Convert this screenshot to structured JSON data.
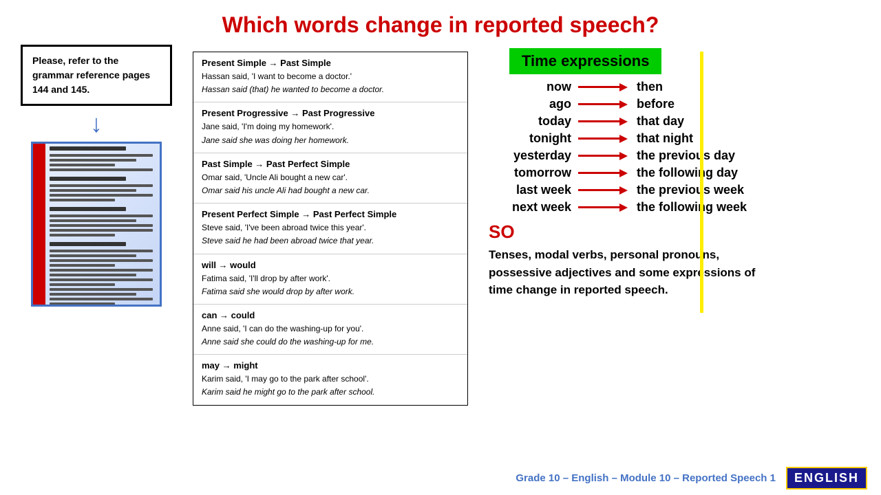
{
  "title": "Which words change in reported speech?",
  "grammar_box": {
    "text": "Please, refer to the grammar reference pages 144 and 145."
  },
  "grammar_sections": [
    {
      "id": "present-simple",
      "title": "Present Simple → Past Simple",
      "lines": [
        "Hassan said, 'I want to become a doctor.'",
        "Hassan said (that) he wanted to become a doctor."
      ],
      "italic": [
        false,
        true
      ]
    },
    {
      "id": "present-progressive",
      "title": "Present Progressive → Past Progressive",
      "lines": [
        "Jane said, 'I'm doing my homework'.",
        "Jane said she was doing her homework."
      ],
      "italic": [
        false,
        true
      ]
    },
    {
      "id": "past-simple",
      "title": "Past Simple → Past Perfect Simple",
      "lines": [
        "Omar said, 'Uncle Ali bought a new car'.",
        "Omar said his uncle Ali had bought a new car."
      ],
      "italic": [
        false,
        true
      ]
    },
    {
      "id": "present-perfect",
      "title": "Present Perfect Simple → Past Perfect Simple",
      "lines": [
        "Steve said, 'I've been abroad twice this year'.",
        "Steve said he had been abroad twice that year."
      ],
      "italic": [
        false,
        true
      ]
    },
    {
      "id": "will-would",
      "title": "will → would",
      "lines": [
        "Fatima said, 'I'll drop by after work'.",
        "Fatima said she would drop by after work."
      ],
      "italic": [
        false,
        true
      ]
    },
    {
      "id": "can-could",
      "title": "can → could",
      "lines": [
        "Anne said, 'I can do the washing-up for you'.",
        "Anne said she could do the washing-up for me."
      ],
      "italic": [
        false,
        true
      ]
    },
    {
      "id": "may-might",
      "title": "may → might",
      "lines": [
        "Karim said, 'I may go to the park after school'.",
        "Karim said he might go to the park after school."
      ],
      "italic": [
        false,
        true
      ]
    }
  ],
  "time_expressions": {
    "header": "Time expressions",
    "mappings": [
      {
        "left": "now",
        "right": "then"
      },
      {
        "left": "ago",
        "right": "before"
      },
      {
        "left": "today",
        "right": "that day"
      },
      {
        "left": "tonight",
        "right": "that night"
      },
      {
        "left": "yesterday",
        "right": "the previous day"
      },
      {
        "left": "tomorrow",
        "right": "the following day"
      },
      {
        "left": "last week",
        "right": "the previous week"
      },
      {
        "left": "next week",
        "right": "the following week"
      }
    ],
    "so_label": "SO",
    "so_description": "Tenses, modal verbs, personal pronouns, possessive adjectives and some expressions of time change in reported speech."
  },
  "footer": {
    "text": "Grade 10 – English – Module 10 – Reported Speech 1",
    "logo": "ENGLISH"
  }
}
